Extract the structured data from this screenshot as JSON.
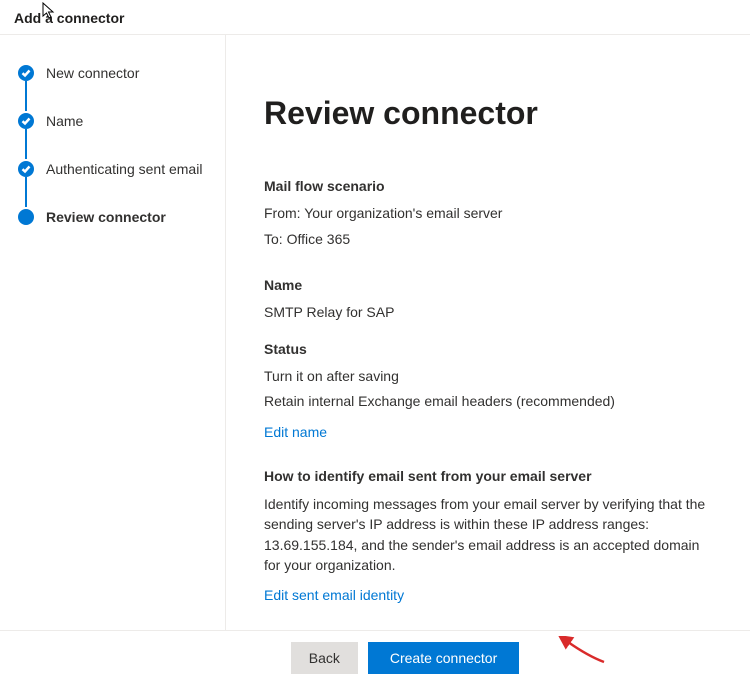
{
  "header": {
    "title": "Add a connector"
  },
  "sidebar": {
    "steps": [
      {
        "label": "New connector",
        "state": "done"
      },
      {
        "label": "Name",
        "state": "done"
      },
      {
        "label": "Authenticating sent email",
        "state": "done"
      },
      {
        "label": "Review connector",
        "state": "current"
      }
    ]
  },
  "content": {
    "page_title": "Review connector",
    "scenario": {
      "heading": "Mail flow scenario",
      "from_label": "From:",
      "from_value": "Your organization's email server",
      "to_label": "To:",
      "to_value": "Office 365"
    },
    "name_section": {
      "heading": "Name",
      "value": "SMTP Relay for SAP"
    },
    "status_section": {
      "heading": "Status",
      "line1": "Turn it on after saving",
      "line2": "Retain internal Exchange email headers (recommended)",
      "edit_link": "Edit name"
    },
    "identify_section": {
      "heading": "How to identify email sent from your email server",
      "body": "Identify incoming messages from your email server by verifying that the sending server's IP address is within these IP address ranges: 13.69.155.184, and the sender's email address is an accepted domain for your organization.",
      "edit_link": "Edit sent email identity"
    }
  },
  "footer": {
    "back_label": "Back",
    "create_label": "Create connector"
  }
}
